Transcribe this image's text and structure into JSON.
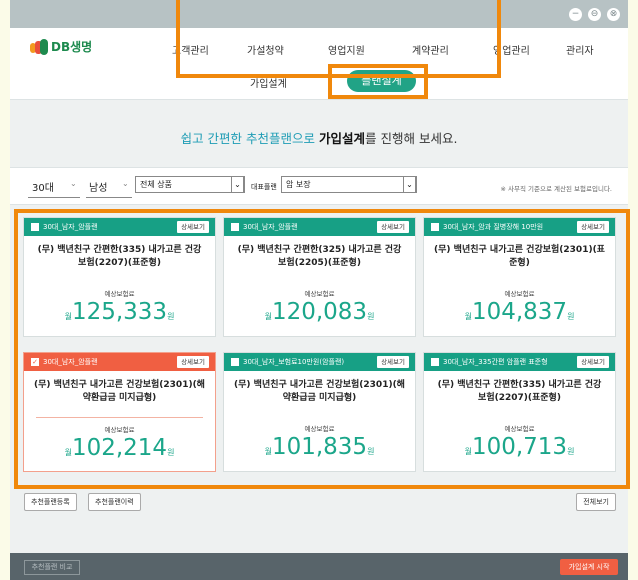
{
  "window": {
    "min": "−",
    "max": "⊖",
    "close": "⊗"
  },
  "brand": {
    "name": "DB생명"
  },
  "nav": {
    "items": [
      "고객관리",
      "가설청약",
      "영업지원",
      "계약관리",
      "영업관리",
      "관리자"
    ],
    "sub": {
      "left": "가입설계",
      "active": "플랜설계"
    }
  },
  "headline": {
    "part1": "쉽고 간편한 추천플랜으로 ",
    "part2": "가입설계",
    "part3": "를 진행해 보세요."
  },
  "filters": {
    "age": "30대",
    "gender": "남성",
    "product": "전체 상품",
    "plan_label": "대표플랜",
    "plan": "암 보장",
    "note": "※ 사무직 기준으로 계산된 보험료입니다."
  },
  "card_common": {
    "detail": "상세보기",
    "premium_label": "예상보험료",
    "won_prefix": "월",
    "won_suffix": "원"
  },
  "cards": [
    {
      "tag": "30대_남자_암플랜",
      "title": "(무) 백년친구 간편한(335) 내가고른 건강보험(2207)(표준형)",
      "premium": "125,333",
      "selected": false
    },
    {
      "tag": "30대_남자_암플랜",
      "title": "(무) 백년친구 간편한(325) 내가고른 건강보험(2205)(표준형)",
      "premium": "120,083",
      "selected": false
    },
    {
      "tag": "30대_남자_암과 질병장해 10만원",
      "title": "(무) 백년친구 내가고른 건강보험(2301)(표준형)",
      "premium": "104,837",
      "selected": false
    },
    {
      "tag": "30대_남자_암플랜",
      "title": "(무) 백년친구 내가고른 건강보험(2301)(해약환급금 미지급형)",
      "premium": "102,214",
      "selected": true
    },
    {
      "tag": "30대_남자_보험료10만원(암플랜)",
      "title": "(무) 백년친구 내가고른 건강보험(2301)(해약환급금 미지급형)",
      "premium": "101,835",
      "selected": false
    },
    {
      "tag": "30대_남자_335간편 암플랜 표준형",
      "title": "(무) 백년친구 간편한(335) 내가고른 건강보험(2207)(표준형)",
      "premium": "100,713",
      "selected": false
    }
  ],
  "actions": {
    "register": "추천플랜등록",
    "history": "추천플랜이력",
    "view_all": "전체보기"
  },
  "footer": {
    "compare": "추천플랜 비교",
    "start": "가입설계 시작"
  },
  "colors": {
    "accent_green": "#17a085",
    "selected_orange": "#f05f42",
    "highlight": "#f0880c"
  }
}
